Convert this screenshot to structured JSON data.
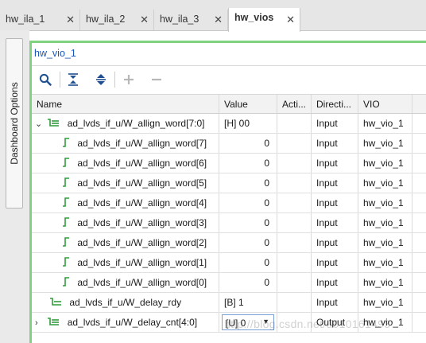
{
  "tabs": [
    {
      "label": "hw_ila_1",
      "close": "✕"
    },
    {
      "label": "hw_ila_2",
      "close": "✕"
    },
    {
      "label": "hw_ila_3",
      "close": "✕"
    },
    {
      "label": "hw_vios",
      "close": "✕",
      "active": true
    }
  ],
  "sidebar": {
    "dashboard_options": "Dashboard Options"
  },
  "panel": {
    "title": "hw_vio_1"
  },
  "toolbar": {
    "icons": [
      "search-icon",
      "collapse-all-icon",
      "expand-all-icon",
      "add-icon",
      "remove-icon"
    ]
  },
  "table": {
    "headers": {
      "name": "Name",
      "value": "Value",
      "activity": "Acti...",
      "direction": "Directi...",
      "vio": "VIO"
    },
    "rows": [
      {
        "toggle": "⌄",
        "name": "ad_lvds_if_u/W_allign_word[7:0]",
        "value": "[H] 00",
        "activity": "",
        "direction": "Input",
        "vio": "hw_vio_1",
        "icon": "bus-icon"
      },
      {
        "toggle": "",
        "name": "ad_lvds_if_u/W_allign_word[7]",
        "value": "0",
        "activity": "",
        "direction": "Input",
        "vio": "hw_vio_1",
        "icon": "signal-icon"
      },
      {
        "toggle": "",
        "name": "ad_lvds_if_u/W_allign_word[6]",
        "value": "0",
        "activity": "",
        "direction": "Input",
        "vio": "hw_vio_1",
        "icon": "signal-icon"
      },
      {
        "toggle": "",
        "name": "ad_lvds_if_u/W_allign_word[5]",
        "value": "0",
        "activity": "",
        "direction": "Input",
        "vio": "hw_vio_1",
        "icon": "signal-icon"
      },
      {
        "toggle": "",
        "name": "ad_lvds_if_u/W_allign_word[4]",
        "value": "0",
        "activity": "",
        "direction": "Input",
        "vio": "hw_vio_1",
        "icon": "signal-icon"
      },
      {
        "toggle": "",
        "name": "ad_lvds_if_u/W_allign_word[3]",
        "value": "0",
        "activity": "",
        "direction": "Input",
        "vio": "hw_vio_1",
        "icon": "signal-icon"
      },
      {
        "toggle": "",
        "name": "ad_lvds_if_u/W_allign_word[2]",
        "value": "0",
        "activity": "",
        "direction": "Input",
        "vio": "hw_vio_1",
        "icon": "signal-icon"
      },
      {
        "toggle": "",
        "name": "ad_lvds_if_u/W_allign_word[1]",
        "value": "0",
        "activity": "",
        "direction": "Input",
        "vio": "hw_vio_1",
        "icon": "signal-icon"
      },
      {
        "toggle": "",
        "name": "ad_lvds_if_u/W_allign_word[0]",
        "value": "0",
        "activity": "",
        "direction": "Input",
        "vio": "hw_vio_1",
        "icon": "signal-icon"
      },
      {
        "toggle": "",
        "name": "ad_lvds_if_u/W_delay_rdy",
        "value": "[B] 1",
        "activity": "",
        "direction": "Input",
        "vio": "hw_vio_1",
        "icon": "bus-icon"
      },
      {
        "toggle": "›",
        "name": "ad_lvds_if_u/W_delay_cnt[4:0]",
        "value": "[U] 0",
        "activity": "",
        "direction": "Output",
        "vio": "hw_vio_1",
        "icon": "bus-icon"
      }
    ]
  },
  "watermark": "http://blog.csdn.net/u010161493",
  "colors": {
    "accent_border": "#7fd37f",
    "link_blue": "#1a55b5",
    "icon_green": "#2e9e3a"
  }
}
